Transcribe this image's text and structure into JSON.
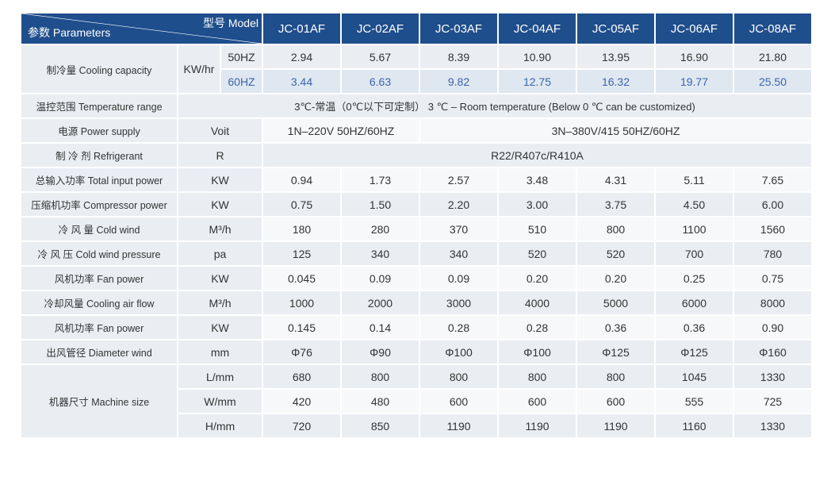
{
  "header": {
    "model_label": "型号 Model",
    "param_label": "参数 Parameters",
    "models": [
      "JC-01AF",
      "JC-02AF",
      "JC-03AF",
      "JC-04AF",
      "JC-05AF",
      "JC-06AF",
      "JC-08AF"
    ]
  },
  "cooling": {
    "label": "制冷量 Cooling capacity",
    "unit": "KW/hr",
    "hz50": "50HZ",
    "hz60": "60HZ",
    "values50": [
      "2.94",
      "5.67",
      "8.39",
      "10.90",
      "13.95",
      "16.90",
      "21.80"
    ],
    "values60": [
      "3.44",
      "6.63",
      "9.82",
      "12.75",
      "16.32",
      "19.77",
      "25.50"
    ]
  },
  "temperature": {
    "label": "温控范围 Temperature range",
    "value": "3℃-常温（0℃以下可定制） 3 ℃ – Room temperature (Below 0 ℃ can be customized)"
  },
  "power_supply": {
    "label": "电源 Power supply",
    "unit": "Voit",
    "value1": "1N–220V 50HZ/60HZ",
    "value2": "3N–380V/415  50HZ/60HZ"
  },
  "refrigerant": {
    "label": "制 冷 剂 Refrigerant",
    "unit": "R",
    "value": "R22/R407c/R410A"
  },
  "rows": [
    {
      "label": "总输入功率 Total input power",
      "unit": "KW",
      "values": [
        "0.94",
        "1.73",
        "2.57",
        "3.48",
        "4.31",
        "5.11",
        "7.65"
      ]
    },
    {
      "label": "压缩机功率 Compressor power",
      "unit": "KW",
      "values": [
        "0.75",
        "1.50",
        "2.20",
        "3.00",
        "3.75",
        "4.50",
        "6.00"
      ]
    },
    {
      "label": "冷 风 量 Cold wind",
      "unit": "M³/h",
      "values": [
        "180",
        "280",
        "370",
        "510",
        "800",
        "1100",
        "1560"
      ]
    },
    {
      "label": "冷 风 压 Cold wind pressure",
      "unit": "pa",
      "values": [
        "125",
        "340",
        "340",
        "520",
        "520",
        "700",
        "780"
      ]
    },
    {
      "label": "风机功率 Fan power",
      "unit": "KW",
      "values": [
        "0.045",
        "0.09",
        "0.09",
        "0.20",
        "0.20",
        "0.25",
        "0.75"
      ]
    },
    {
      "label": "冷却风量 Cooling air flow",
      "unit": "M³/h",
      "values": [
        "1000",
        "2000",
        "3000",
        "4000",
        "5000",
        "6000",
        "8000"
      ]
    },
    {
      "label": "风机功率 Fan power",
      "unit": "KW",
      "values": [
        "0.145",
        "0.14",
        "0.28",
        "0.28",
        "0.36",
        "0.36",
        "0.90"
      ]
    },
    {
      "label": "出风管径 Diameter wind",
      "unit": "mm",
      "values": [
        "Φ76",
        "Φ90",
        "Φ100",
        "Φ100",
        "Φ125",
        "Φ125",
        "Φ160"
      ]
    }
  ],
  "machine": {
    "label": "机器尺寸 Machine size",
    "dims": [
      {
        "unit": "L/mm",
        "values": [
          "680",
          "800",
          "800",
          "800",
          "800",
          "1045",
          "1330"
        ]
      },
      {
        "unit": "W/mm",
        "values": [
          "420",
          "480",
          "600",
          "600",
          "600",
          "555",
          "725"
        ]
      },
      {
        "unit": "H/mm",
        "values": [
          "720",
          "850",
          "1190",
          "1190",
          "1190",
          "1160",
          "1330"
        ]
      }
    ]
  }
}
